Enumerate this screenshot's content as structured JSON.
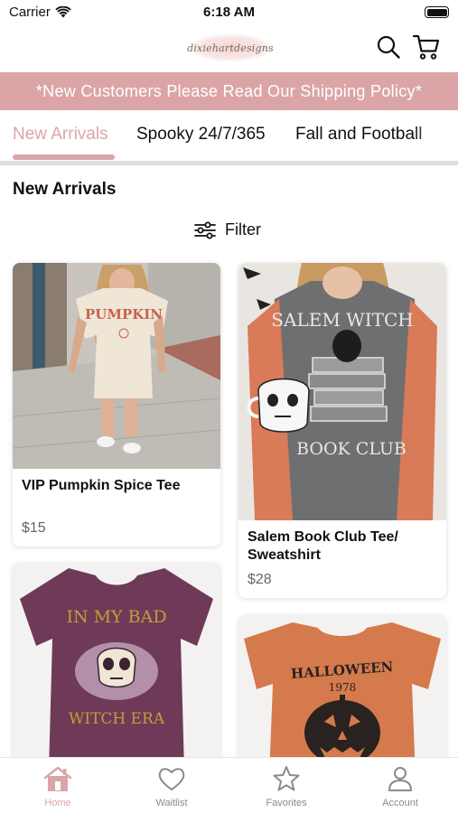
{
  "status_bar": {
    "carrier": "Carrier",
    "time": "6:18 AM",
    "battery_level": 1.0
  },
  "header": {
    "logo_text": "dixiehartdesigns",
    "search_icon": "search-icon",
    "cart_icon": "cart-icon"
  },
  "banner": {
    "text": "*New Customers Please Read Our Shipping Policy*",
    "color": "#dba5a7"
  },
  "tabs": [
    {
      "label": "New Arrivals",
      "active": true
    },
    {
      "label": "Spooky 24/7/365",
      "active": false
    },
    {
      "label": "Fall and Football",
      "active": false
    }
  ],
  "section": {
    "title": "New Arrivals",
    "filter_label": "Filter",
    "filter_icon": "sliders-icon"
  },
  "products": [
    {
      "title": "VIP Pumpkin Spice Tee",
      "price": "$15",
      "image_text": "PUMPKIN"
    },
    {
      "title": "Salem Book Club Tee/ Sweatshirt",
      "price": "$28",
      "image_text_top": "SALEM WITCH",
      "image_text_bottom": "BOOK CLUB"
    },
    {
      "title": "",
      "price": "",
      "image_text_top": "IN MY BAD",
      "image_text_bottom": "WITCH ERA"
    },
    {
      "title": "",
      "price": "",
      "image_text_top": "HALLOWEEN",
      "image_text_bottom": "1978"
    }
  ],
  "bottom_nav": [
    {
      "label": "Home",
      "icon": "home-icon",
      "active": true
    },
    {
      "label": "Waitlist",
      "icon": "heart-icon",
      "active": false
    },
    {
      "label": "Favorites",
      "icon": "star-icon",
      "active": false
    },
    {
      "label": "Account",
      "icon": "person-icon",
      "active": false
    }
  ],
  "colors": {
    "accent": "#dba5a7",
    "inactive_nav": "#8a8a8a"
  }
}
